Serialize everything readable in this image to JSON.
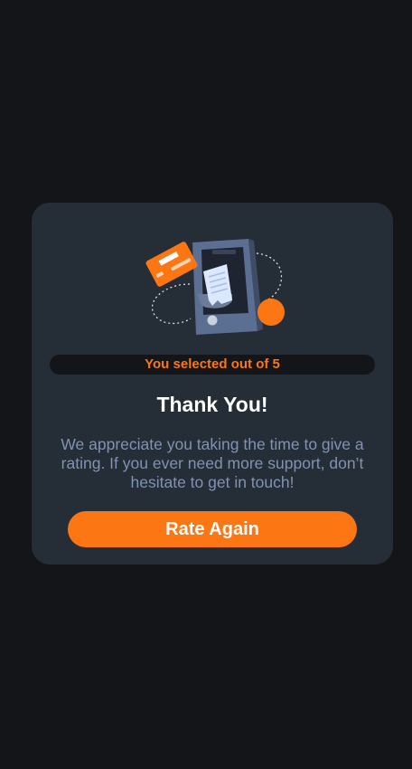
{
  "card": {
    "illustration_icon": "phone-payment-receipt-illustration",
    "badge_text": "You selected out of 5",
    "title": "Thank You!",
    "description": "We appreciate you taking the time to give a rating. If you ever need more support, don’t hesitate to get in touch!",
    "button_label": "Rate Again"
  },
  "colors": {
    "background": "#131518",
    "card": "#252d37",
    "accent": "#fc7614",
    "muted_text": "#8193b2",
    "title_text": "#ffffff"
  }
}
